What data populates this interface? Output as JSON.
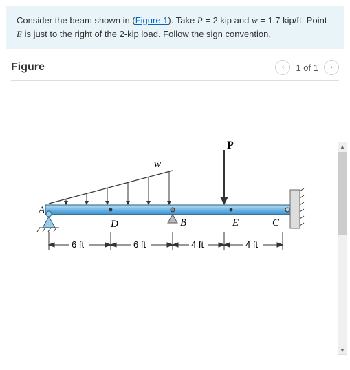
{
  "problem": {
    "text_parts": {
      "p1": "Consider the beam shown in (",
      "link": "Figure 1",
      "p2": "). Take ",
      "var1": "P",
      "p3": " = 2 kip and ",
      "var2": "w",
      "p4": " = 1.7 kip/ft. Point ",
      "var3": "E",
      "p5": " is just to the right of the 2-kip load. Follow the sign convention."
    }
  },
  "figure_header": {
    "title": "Figure",
    "nav": {
      "prev": "‹",
      "counter": "1 of 1",
      "next": "›"
    }
  },
  "diagram": {
    "load_w_label": "w",
    "load_P_label": "P",
    "points": {
      "A": "A",
      "D": "D",
      "B": "B",
      "E": "E",
      "C": "C"
    },
    "dims": {
      "d1": "6 ft",
      "d2": "6 ft",
      "d3": "4 ft",
      "d4": "4 ft"
    }
  },
  "chart_data": {
    "type": "diagram",
    "description": "Simply supported beam with pin at A and roller at C. Triangular distributed load w from B to A (max at B). Point load P between B and C at distance 4 ft from B (point E).",
    "P_kip": 2,
    "w_kip_per_ft": 1.7,
    "spans_ft": {
      "A_to_D": 6,
      "D_to_B": 6,
      "B_to_E": 4,
      "E_to_C": 4
    },
    "points": [
      "A",
      "D",
      "B",
      "E",
      "C"
    ],
    "supports": {
      "A": "pin",
      "C": "roller"
    },
    "distributed_load": {
      "shape": "triangular",
      "from": "A",
      "to": "B",
      "max_at": "B",
      "max_value_kip_per_ft": 1.7
    },
    "point_load": {
      "at": "E",
      "value_kip": 2,
      "direction": "down"
    }
  }
}
